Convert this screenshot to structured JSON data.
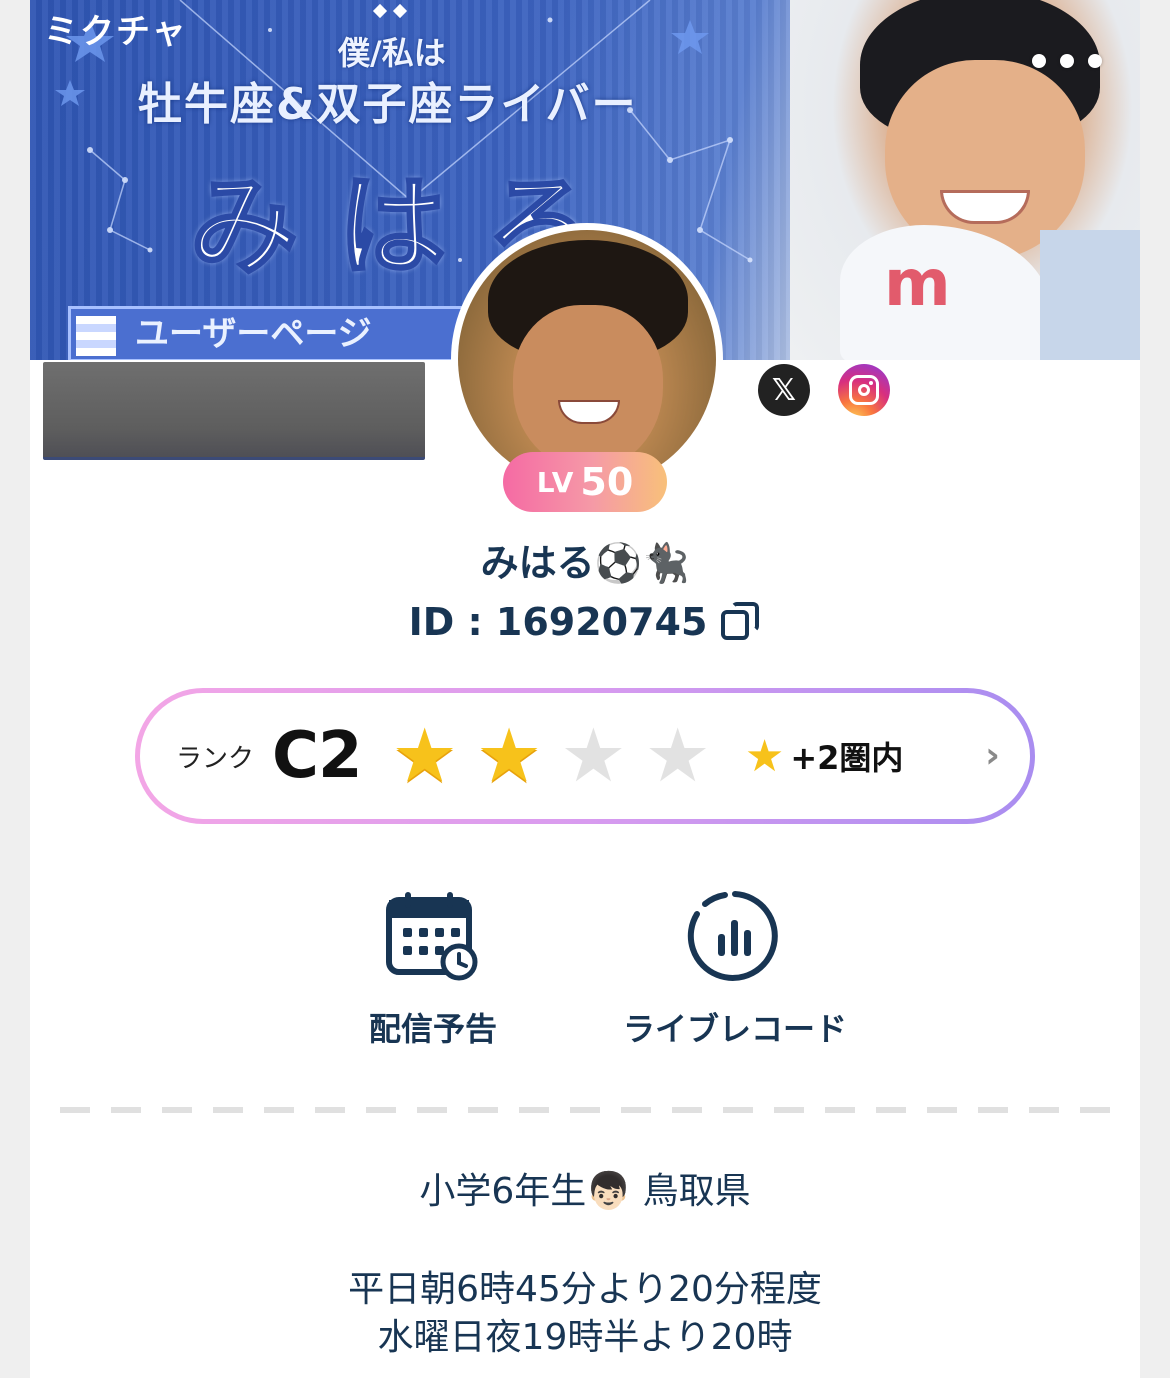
{
  "banner": {
    "brand": "ミクチャ",
    "subtitle": "僕/私は",
    "title_line1": "牡牛座&双子座ライバー",
    "title_line2": "みはる",
    "userpage_label": "ユーザーページ"
  },
  "header": {
    "more_icon": "ellipsis-icon"
  },
  "profile": {
    "level_label": "LV",
    "level_value": "50",
    "name": "みはる⚽🐈‍⬛",
    "id_text": "ID : 16920745"
  },
  "social": {
    "x_icon": "x-logo-icon",
    "x_glyph": "𝕏",
    "instagram_icon": "instagram-icon"
  },
  "rank": {
    "label": "ランク",
    "value": "C2",
    "stars_total": 4,
    "stars_filled": 2,
    "range_text": "+2圏内",
    "star_glyph": "★",
    "chevron": "›"
  },
  "actions": {
    "schedule_label": "配信予告",
    "record_label": "ライブレコード"
  },
  "bio": {
    "line1": "小学6年生👦🏻 鳥取県",
    "line2": "平日朝6時45分より20分程度",
    "line3": "水曜日夜19時半より20時"
  },
  "colors": {
    "text_primary": "#183553",
    "rank_gradient_start": "#f3a6e6",
    "rank_gradient_end": "#a98df0",
    "level_gradient_start": "#f56aa4",
    "level_gradient_end": "#f8c07a",
    "star_on": "#f7c21b",
    "star_off": "#e2e2e2"
  }
}
